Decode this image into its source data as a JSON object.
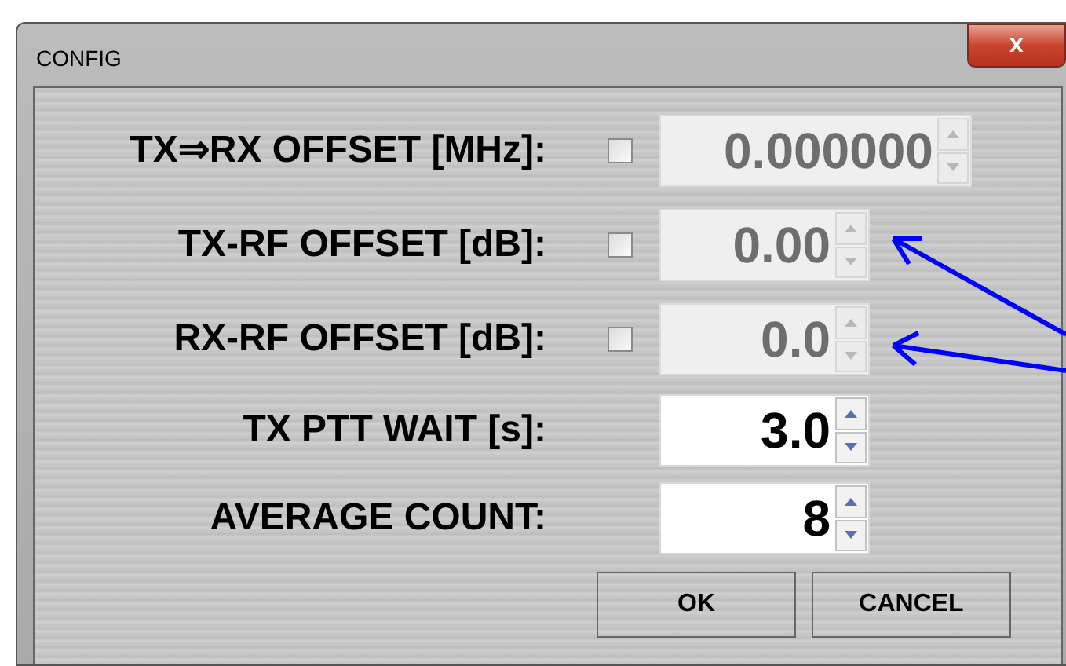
{
  "window": {
    "title": "CONFIG",
    "close": "x"
  },
  "rows": [
    {
      "label": "TX⇒RX OFFSET [MHz]:",
      "checkbox": {
        "checked": false
      },
      "field": {
        "value": "0.000000",
        "disabled": true
      },
      "pointed": false
    },
    {
      "label": "TX-RF OFFSET [dB]:",
      "checkbox": {
        "checked": false
      },
      "field": {
        "value": "0.00",
        "disabled": true
      },
      "pointed": true
    },
    {
      "label": "RX-RF OFFSET [dB]:",
      "checkbox": {
        "checked": false
      },
      "field": {
        "value": "0.0",
        "disabled": true
      },
      "pointed": true
    },
    {
      "label": "TX PTT WAIT [s]:",
      "field": {
        "value": "3.0",
        "disabled": false
      },
      "pointed": false
    },
    {
      "label": "AVERAGE COUNT:",
      "field": {
        "value": "8",
        "disabled": false
      },
      "pointed": false
    }
  ],
  "buttons": [
    "OK",
    "CANCEL"
  ]
}
